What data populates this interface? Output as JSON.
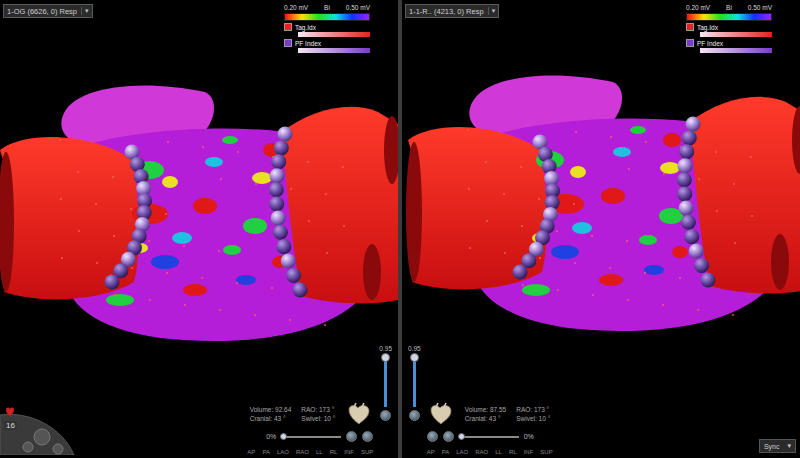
{
  "panels": [
    {
      "title": "1-OG (6626, 0) Resp",
      "dropdown": "▾",
      "legend": {
        "min": "0.20 mV",
        "label": "Bi",
        "max": "0.50 mV",
        "items": [
          {
            "label": "Tag.Idx",
            "color": "#e8201e"
          },
          {
            "label": "PF Index",
            "color": "#7a3cc8"
          }
        ]
      },
      "volume": "Volume: 92.64",
      "rao": "RAO: 173 °",
      "cranial": "Cranial: 43 °",
      "swivel": "Swivel: 10 °",
      "opacity": {
        "reading": "0.95",
        "level": 0.95
      },
      "transparency": {
        "reading": "0%",
        "level": 0
      },
      "views": [
        "AP",
        "PA",
        "LAO",
        "RAO",
        "LL",
        "RL",
        "INF",
        "SUP"
      ]
    },
    {
      "title": "1-1-R.. (4213, 0) Resp",
      "dropdown": "▾",
      "legend": {
        "min": "0.20 mV",
        "label": "Bi",
        "max": "0.50 mV",
        "items": [
          {
            "label": "Tag.Idx",
            "color": "#e8201e"
          },
          {
            "label": "PF Index",
            "color": "#7a3cc8"
          }
        ]
      },
      "volume": "Volume: 87.55",
      "rao": "RAO: 173 °",
      "cranial": "Cranial: 43 °",
      "swivel": "Swivel: 10 °",
      "opacity": {
        "reading": "0.95",
        "level": 0.95
      },
      "transparency": {
        "reading": "0%",
        "level": 0
      },
      "views": [
        "AP",
        "PA",
        "LAO",
        "RAO",
        "LL",
        "RL",
        "INF",
        "SUP"
      ]
    }
  ],
  "frame_count": "16",
  "sync": {
    "label": "Sync",
    "arrow": "▾"
  }
}
